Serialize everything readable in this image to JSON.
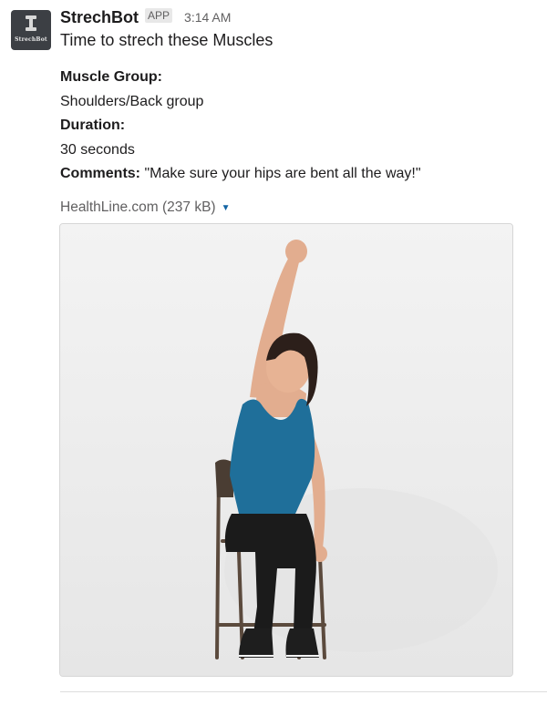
{
  "message": {
    "bot_name": "StrechBot",
    "avatar_label": "StrechBot",
    "app_badge": "APP",
    "timestamp": "3:14 AM",
    "text": "Time to strech these Muscles",
    "fields": {
      "muscle_group_label": "Muscle Group:",
      "muscle_group_value": "Shoulders/Back group",
      "duration_label": "Duration:",
      "duration_value": "30 seconds",
      "comments_label": "Comments:",
      "comments_value": " \"Make sure your hips are bent all the way!\""
    },
    "attachment": {
      "source": "HealthLine.com (237 kB)",
      "caret_icon": "caret-down-icon",
      "image_icon": "woman-seated-side-stretch-photo"
    }
  },
  "colors": {
    "avatar_bg": "#3c3f44",
    "text": "#1d1c1d",
    "muted": "#616061",
    "link": "#1264a3",
    "tank_top": "#1f6f9a"
  }
}
